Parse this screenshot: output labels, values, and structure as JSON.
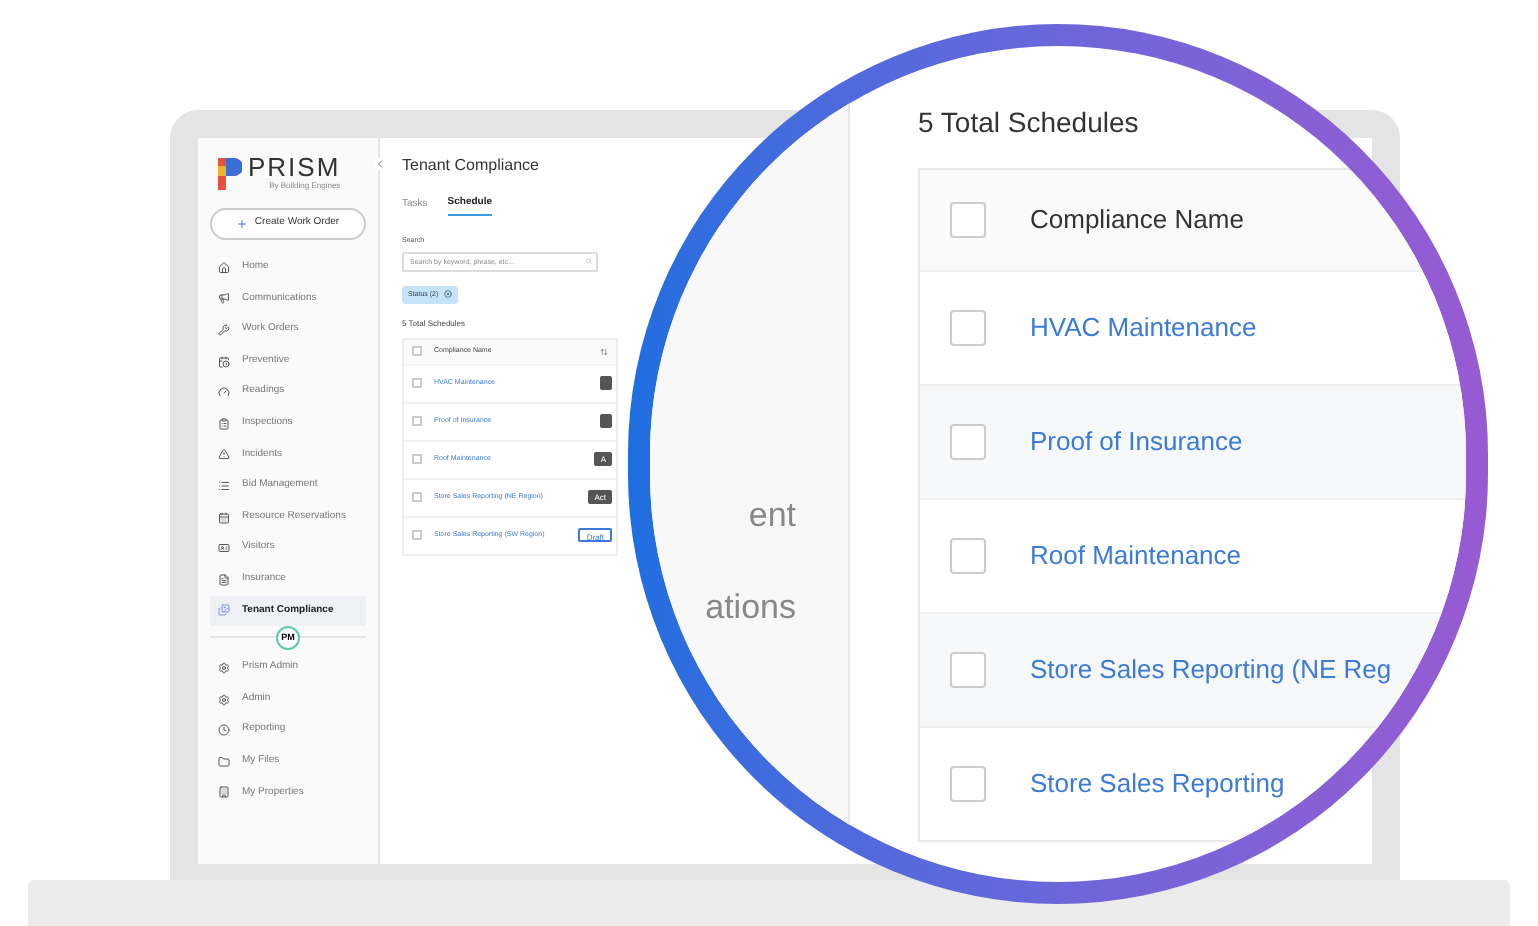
{
  "sidebar": {
    "logo": "PRISM",
    "logo_subtitle": "By Building Engines",
    "create_button": "Create Work Order",
    "items": [
      {
        "label": "Home",
        "selected": false
      },
      {
        "label": "Communications",
        "selected": false
      },
      {
        "label": "Work Orders",
        "selected": false
      },
      {
        "label": "Preventive",
        "selected": false
      },
      {
        "label": "Readings",
        "selected": false
      },
      {
        "label": "Inspections",
        "selected": false
      },
      {
        "label": "Incidents",
        "selected": false
      },
      {
        "label": "Bid Management",
        "selected": false
      },
      {
        "label": "Resource Reservations",
        "selected": false
      },
      {
        "label": "Visitors",
        "selected": false
      },
      {
        "label": "Insurance",
        "selected": false
      },
      {
        "label": "Tenant Compliance",
        "selected": true
      }
    ],
    "avatar": "PM",
    "bottom_items": [
      {
        "label": "Prism Admin"
      },
      {
        "label": "Admin"
      },
      {
        "label": "Reporting"
      },
      {
        "label": "My Files"
      },
      {
        "label": "My Properties"
      }
    ]
  },
  "main": {
    "title": "Tenant Compliance",
    "tabs": [
      {
        "label": "Tasks",
        "selected": false
      },
      {
        "label": "Schedule",
        "selected": true
      }
    ],
    "search": {
      "label": "Search",
      "placeholder": "Search by keyword, phrase, etc..."
    },
    "filter_chip": "Status (2)",
    "count": "5 Total Schedules",
    "column": "Compliance Name",
    "select_all_checked": false,
    "rows": [
      {
        "name": "HVAC Maintenance",
        "checked": false,
        "status": {
          "kind": "active"
        }
      },
      {
        "name": "Proof of Insurance",
        "checked": false,
        "status": {
          "kind": "active"
        }
      },
      {
        "name": "Roof Maintenance",
        "checked": false,
        "status": {
          "kind": "active",
          "label": "A"
        }
      },
      {
        "name": "Store Sales Reporting (NE Region)",
        "checked": false,
        "status": {
          "kind": "active",
          "label": "Act"
        }
      },
      {
        "name": "Store Sales Reporting (SW Region)",
        "checked": false,
        "status": {
          "kind": "draft",
          "label": "Draft"
        }
      }
    ]
  },
  "magnifier": {
    "sidebar_fragments": [
      "ent",
      "ations"
    ],
    "count": "5 Total Schedules",
    "column": "Compliance Name",
    "select_all_checked": false,
    "rows": [
      {
        "name": "HVAC Maintenance",
        "checked": false
      },
      {
        "name": "Proof of Insurance",
        "checked": false
      },
      {
        "name": "Roof Maintenance",
        "checked": false
      },
      {
        "name": "Store Sales Reporting (NE Reg",
        "checked": false
      },
      {
        "name": "Store Sales Reporting",
        "checked": false
      }
    ]
  }
}
